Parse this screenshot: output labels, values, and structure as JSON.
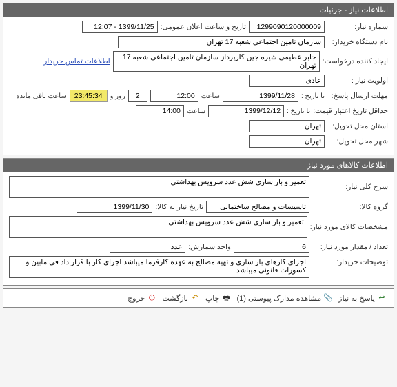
{
  "section1": {
    "title": "اطلاعات نیاز - جزئیات",
    "request_no_label": "شماره نیاز:",
    "request_no": "1299090120000009",
    "announce_label": "تاریخ و ساعت اعلان عمومی:",
    "announce_value": "1399/11/25 - 12:07",
    "buyer_org_label": "نام دستگاه خریدار:",
    "buyer_org": "سازمان تامین اجتماعی شعبه 17 تهران",
    "creator_label": "ایجاد کننده درخواست:",
    "creator": "جابر عظیمی شیره جین کارپرداز  سازمان تامین اجتماعی شعبه 17 تهران",
    "contact_link": "اطلاعات تماس خریدار",
    "priority_label": "اولویت نیاز :",
    "priority": "عادی",
    "deadline_label": "مهلت ارسال پاسخ:",
    "until_label": "تا تاریخ :",
    "deadline_date": "1399/11/28",
    "time_label": "ساعت",
    "deadline_time": "12:00",
    "days_value": "2",
    "days_label": "روز و",
    "countdown": "23:45:34",
    "remaining_label": "ساعت باقی مانده",
    "min_validity_label": "حداقل تاریخ اعتبار قیمت:",
    "min_validity_date": "1399/12/12",
    "min_validity_time": "14:00",
    "province_label": "استان محل تحویل:",
    "province": "تهران",
    "city_label": "شهر محل تحویل:",
    "city": "تهران"
  },
  "section2": {
    "title": "اطلاعات کالاهای مورد نیاز",
    "desc_label": "شرح کلی نیاز:",
    "desc": "تعمیر و باز سازی شش عدد سرویس بهداشتی",
    "group_label": "گروه کالا:",
    "group": "تاسیسات و مصالح ساختمانی",
    "need_date_label": "تاریخ نیاز به کالا:",
    "need_date": "1399/11/30",
    "spec_label": "مشخصات کالای مورد نیاز:",
    "spec": "تعمیر و باز سازی شش عدد سرویس بهداشتی",
    "qty_label": "تعداد / مقدار مورد نیاز:",
    "qty": "6",
    "unit_count_label": "واحد شمارش:",
    "unit_count": "عدد",
    "notes_label": "توضیحات خریدار:",
    "notes": "اجرای کارهای باز سازی و تهیه مصالح به عهده کارفرما میباشد اجرای کار با قرار داد فی مابین و کسورات قانونی میباشد"
  },
  "toolbar": {
    "reply": "پاسخ به نیاز",
    "attachments": "مشاهده مدارک پیوستی (1)",
    "print": "چاپ",
    "back": "بازگشت",
    "exit": "خروج"
  }
}
